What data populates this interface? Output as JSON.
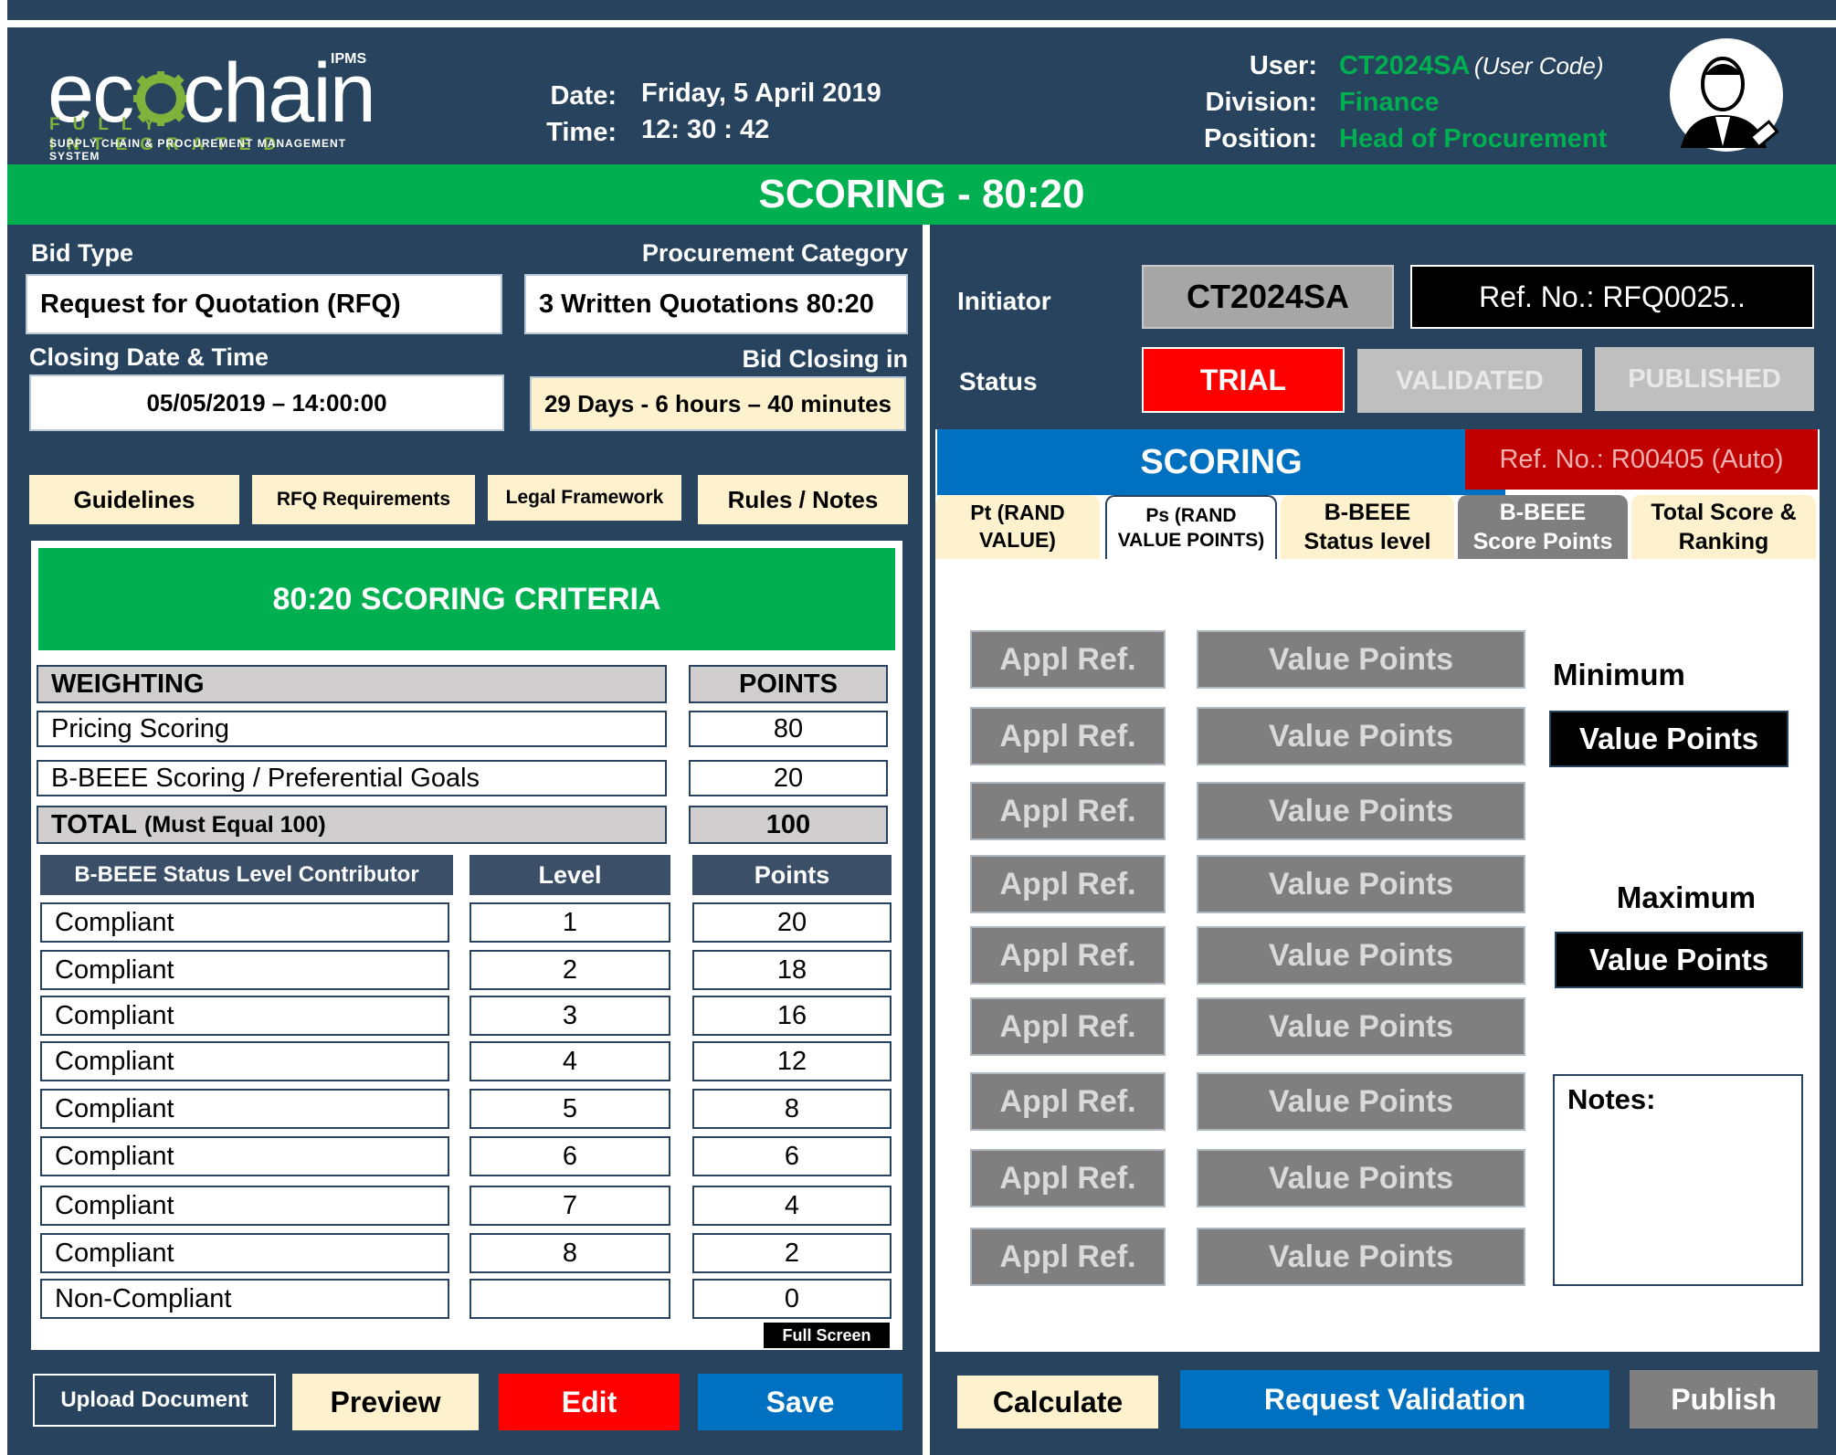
{
  "header": {
    "logo": {
      "text_left": "ec",
      "text_right": "chain",
      "superscript": "IPMS",
      "tagline": "FULLY INTEGRATED",
      "subtitle": "SUPPLY CHAIN & PROCUREMENT MANAGEMENT SYSTEM"
    },
    "date_label": "Date:",
    "date_value": "Friday, 5 April 2019",
    "time_label": "Time:",
    "time_value": "12: 30 : 42",
    "user_label": "User:",
    "user_code": "CT2024SA",
    "user_code_note": "(User Code)",
    "division_label": "Division:",
    "division_value": "Finance",
    "position_label": "Position:",
    "position_value": "Head of Procurement"
  },
  "title": "SCORING - 80:20",
  "left": {
    "bid_type_label": "Bid Type",
    "bid_type_value": "Request for Quotation (RFQ)",
    "proc_category_label": "Procurement Category",
    "proc_category_value": "3 Written Quotations  80:20",
    "closing_label": "Closing Date & Time",
    "closing_value": "05/05/2019 – 14:00:00",
    "bid_closing_label": "Bid Closing in",
    "bid_closing_value": "29 Days - 6 hours – 40 minutes",
    "tabs": [
      "Guidelines",
      "RFQ Requirements",
      "Legal Framework",
      "Rules / Notes"
    ],
    "criteria_title": "80:20 SCORING CRITERIA",
    "weighting_header": "WEIGHTING",
    "points_header": "POINTS",
    "weights": [
      {
        "label": "Pricing Scoring",
        "points": "80"
      },
      {
        "label": "B-BEEE  Scoring / Preferential Goals",
        "points": "20"
      }
    ],
    "total_label": "TOTAL",
    "total_note": "(Must Equal 100)",
    "total_points": "100",
    "status_header": "B-BEEE Status Level Contributor",
    "level_header": "Level",
    "status_points_header": "Points",
    "levels": [
      {
        "label": "Compliant",
        "level": "1",
        "points": "20"
      },
      {
        "label": "Compliant",
        "level": "2",
        "points": "18"
      },
      {
        "label": "Compliant",
        "level": "3",
        "points": "16"
      },
      {
        "label": "Compliant",
        "level": "4",
        "points": "12"
      },
      {
        "label": "Compliant",
        "level": "5",
        "points": "8"
      },
      {
        "label": "Compliant",
        "level": "6",
        "points": "6"
      },
      {
        "label": "Compliant",
        "level": "7",
        "points": "4"
      },
      {
        "label": "Compliant",
        "level": "8",
        "points": "2"
      },
      {
        "label": "Non-Compliant",
        "level": "",
        "points": "0"
      }
    ],
    "full_screen": "Full Screen",
    "buttons": {
      "upload": "Upload Document",
      "preview": "Preview",
      "edit": "Edit",
      "save": "Save"
    }
  },
  "right": {
    "initiator_label": "Initiator",
    "initiator_value": "CT2024SA",
    "ref_no": "Ref. No.: RFQ0025..",
    "status_label": "Status",
    "status_trial": "TRIAL",
    "status_validated": "VALIDATED",
    "status_published": "PUBLISHED",
    "scoring_title": "SCORING",
    "scoring_ref": "Ref. No.: R00405 (Auto)",
    "tabs": [
      {
        "line1": "Pt (RAND",
        "line2": "VALUE)"
      },
      {
        "line1": "Ps (RAND",
        "line2": "VALUE POINTS)"
      },
      {
        "line1": "B-BEEE",
        "line2": "Status level"
      },
      {
        "line1": "B-BEEE",
        "line2": "Score Points"
      },
      {
        "line1": "Total Score &",
        "line2": "Ranking"
      }
    ],
    "appl_ref_label": "Appl Ref.",
    "value_points_label": "Value Points",
    "rows": 9,
    "minimum_label": "Minimum",
    "minimum_value": "Value Points",
    "maximum_label": "Maximum",
    "maximum_value": "Value Points",
    "notes_label": "Notes:",
    "buttons": {
      "calculate": "Calculate",
      "request_validation": "Request Validation",
      "publish": "Publish"
    }
  },
  "colors": {
    "navy": "#27435e",
    "green": "#00b050",
    "cream": "#fdf2cd",
    "red": "#ff0000",
    "blue": "#0070c0",
    "gray": "#7f7f7f"
  }
}
